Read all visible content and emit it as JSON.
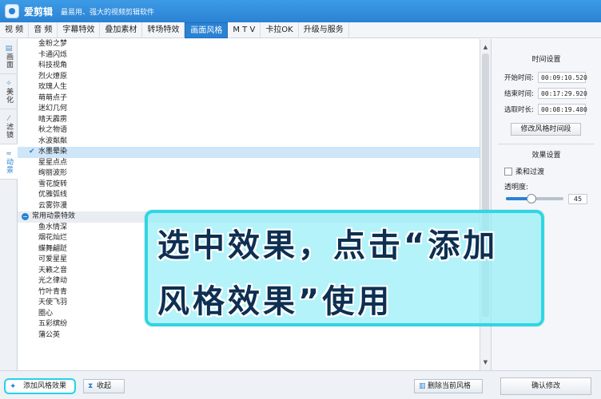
{
  "app": {
    "title": "爱剪辑",
    "slogan": "最易用、强大的视频剪辑软件"
  },
  "menu": [
    {
      "label": "视  频",
      "active": false
    },
    {
      "label": "音  频",
      "active": false
    },
    {
      "label": "字幕特效",
      "active": false
    },
    {
      "label": "叠加素材",
      "active": false
    },
    {
      "label": "转场特效",
      "active": false
    },
    {
      "label": "画面风格",
      "active": true
    },
    {
      "label": "M T V",
      "active": false
    },
    {
      "label": "卡拉OK",
      "active": false
    },
    {
      "label": "升级与服务",
      "active": false
    }
  ],
  "side_tabs": [
    {
      "label": "画面",
      "icon": "frame-icon",
      "glyph": "▤",
      "active": false
    },
    {
      "label": "美化",
      "icon": "beautify-icon",
      "glyph": "✧",
      "active": false
    },
    {
      "label": "滤镜",
      "icon": "filter-icon",
      "glyph": "⁄",
      "active": false
    },
    {
      "label": "动景",
      "icon": "motion-icon",
      "glyph": "≈",
      "active": true
    }
  ],
  "effects_list": [
    {
      "type": "item",
      "label": "金粉之梦"
    },
    {
      "type": "item",
      "label": "卡通闪烁"
    },
    {
      "type": "item",
      "label": "科技视角"
    },
    {
      "type": "item",
      "label": "烈火燎原"
    },
    {
      "type": "item",
      "label": "玫瑰人生"
    },
    {
      "type": "item",
      "label": "萌萌点子"
    },
    {
      "type": "item",
      "label": "迷幻几何"
    },
    {
      "type": "item",
      "label": "晴天霹雳"
    },
    {
      "type": "item",
      "label": "秋之物语"
    },
    {
      "type": "item",
      "label": "水波粼粼"
    },
    {
      "type": "item",
      "label": "水墨晕染",
      "selected": true
    },
    {
      "type": "item",
      "label": "星星点点"
    },
    {
      "type": "item",
      "label": "绚丽波形"
    },
    {
      "type": "item",
      "label": "雪花旋转"
    },
    {
      "type": "item",
      "label": "优雅弧线"
    },
    {
      "type": "item",
      "label": "云雾弥漫"
    },
    {
      "type": "group",
      "label": "常用动景特效"
    },
    {
      "type": "item",
      "label": "鱼水情深"
    },
    {
      "type": "item",
      "label": "烟花灿烂"
    },
    {
      "type": "item",
      "label": "蝶舞翩跹"
    },
    {
      "type": "item",
      "label": "可爱星星"
    },
    {
      "type": "item",
      "label": "天籁之音"
    },
    {
      "type": "item",
      "label": "光之律动"
    },
    {
      "type": "item",
      "label": "竹叶青青"
    },
    {
      "type": "item",
      "label": "天使飞羽"
    },
    {
      "type": "item",
      "label": "圈心"
    },
    {
      "type": "item",
      "label": "五彩缤纷"
    },
    {
      "type": "item",
      "label": "蒲公英"
    }
  ],
  "time_settings": {
    "title": "时间设置",
    "start_label": "开始时间:",
    "start_value": "00:09:10.520",
    "end_label": "结束时间:",
    "end_value": "00:17:29.920",
    "duration_label": "选取时长:",
    "duration_value": "00:08:19.400",
    "modify_button": "修改风格时间段"
  },
  "effect_settings": {
    "title": "效果设置",
    "soft_transition_label": "柔和过渡",
    "soft_transition_checked": false,
    "opacity_label": "透明度:",
    "opacity_value": "45",
    "opacity_fraction": 0.45
  },
  "bottom": {
    "add_style_label": "添加风格效果",
    "collapse_label": "收起",
    "delete_style_label": "删除当前风格",
    "confirm_label": "确认修改"
  },
  "overlay": {
    "line1": "选中效果，点击“添加",
    "line2": "风格效果”使用"
  },
  "colors": {
    "accent": "#2a82d3",
    "overlay_border": "#2fd6e3",
    "selected_row": "#cfe5f8"
  }
}
